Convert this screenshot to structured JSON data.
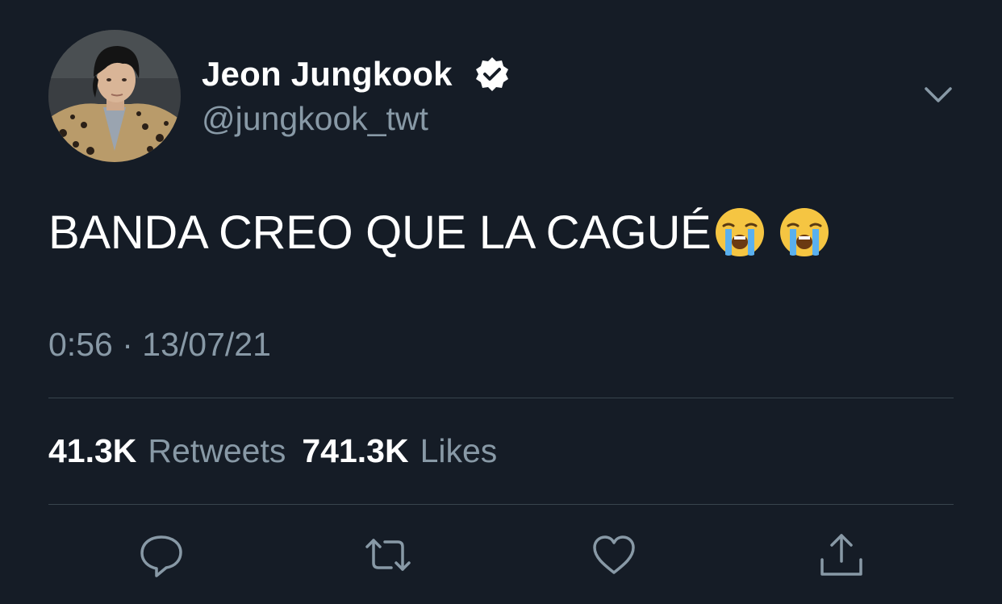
{
  "tweet": {
    "author": {
      "display_name": "Jeon Jungkook",
      "handle": "@jungkook_twt",
      "avatar_icon": "profile-photo",
      "verified_icon": "verified-badge-icon"
    },
    "text": "BANDA CREO QUE LA CAGUÉ",
    "emojis": [
      "loudly-crying-face",
      "loudly-crying-face"
    ],
    "time": "0:56",
    "separator": "·",
    "date": "13/07/21",
    "stats": {
      "retweets_count": "41.3K",
      "retweets_label": "Retweets",
      "likes_count": "741.3K",
      "likes_label": "Likes"
    },
    "actions": [
      "reply-icon",
      "retweet-icon",
      "like-icon",
      "share-icon"
    ]
  },
  "colors": {
    "background": "#151c26",
    "primary_text": "#ffffff",
    "secondary_text": "#8899a6",
    "divider": "#38444d"
  }
}
